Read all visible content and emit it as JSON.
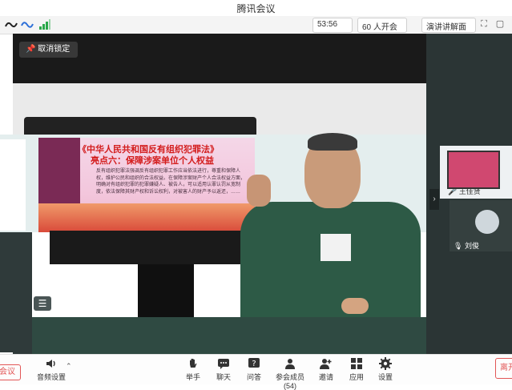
{
  "window": {
    "title": "腾讯会议"
  },
  "status": {
    "stat1": "53:56",
    "stat2": "60 人开会",
    "stat3": "演讲讲解面",
    "signal_color": "#2aa84a"
  },
  "stage": {
    "unlock_label": "取消锁定",
    "slide_title_line1": "《中华人民共和国反有组织犯罪法》",
    "slide_title_line2": "亮点六：保障涉案单位个人权益",
    "slide_body": "反有组织犯罪法强调反有组织犯罪工作应当依法进行，尊重和保障人权，维护公民和组织的合法权益。在保障涉案财产个人合法权益方面，明确对有组织犯罪的犯罪嫌疑人、被告人，可以适用认罪认罚从宽制度，依法保障其财产权和诉讼权利，对被害人的财产予以返还，……",
    "menu_icon": "list-icon"
  },
  "participants": [
    {
      "name": "王佳贤",
      "icon": "mic-muted-icon"
    },
    {
      "name": "刘俊",
      "icon": "mic-icon"
    }
  ],
  "bottom_bar": {
    "left_label": "会议",
    "audio_label": "音频设置",
    "items": [
      {
        "label": "举手",
        "icon": "hand-icon"
      },
      {
        "label": "聊天",
        "icon": "chat-icon"
      },
      {
        "label": "问答",
        "icon": "question-icon"
      },
      {
        "label": "参会成员(54)",
        "icon": "members-icon"
      },
      {
        "label": "邀请",
        "icon": "invite-icon"
      },
      {
        "label": "应用",
        "icon": "apps-icon"
      },
      {
        "label": "设置",
        "icon": "settings-icon"
      }
    ],
    "leave_label": "离开"
  }
}
